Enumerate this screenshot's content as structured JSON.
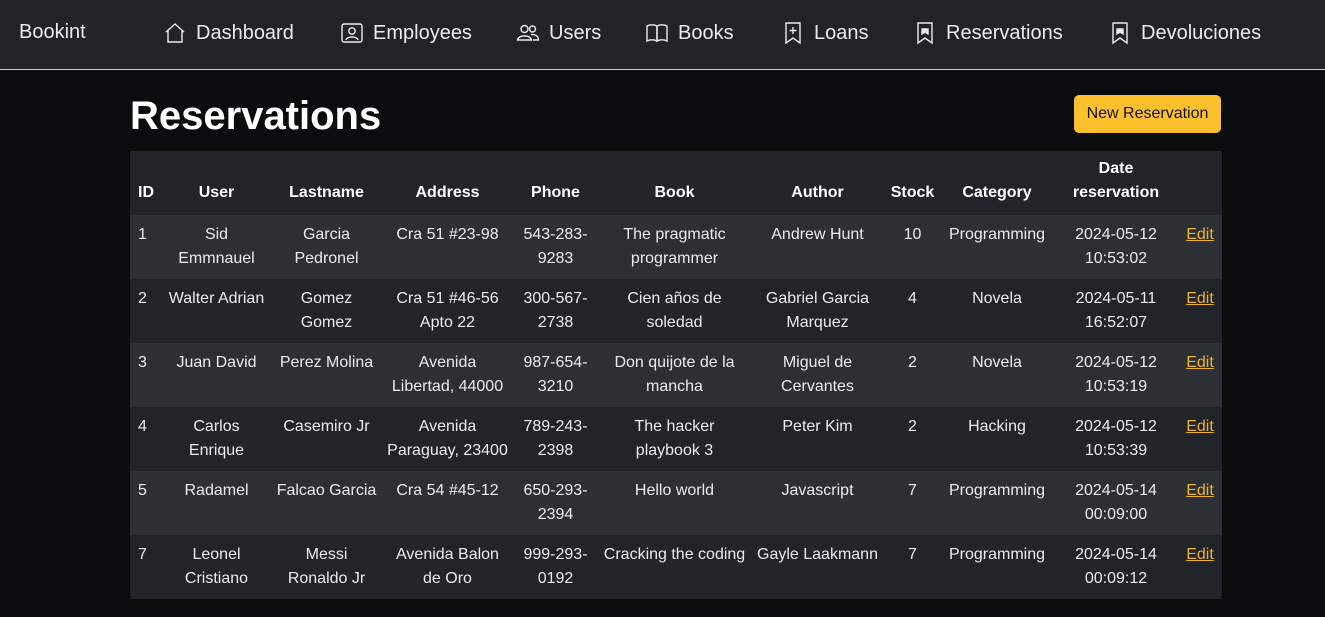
{
  "brand": "Bookint",
  "nav": [
    {
      "label": "Dashboard",
      "icon": "house-icon"
    },
    {
      "label": "Employees",
      "icon": "person-badge-icon"
    },
    {
      "label": "Users",
      "icon": "people-icon"
    },
    {
      "label": "Books",
      "icon": "book-icon"
    },
    {
      "label": "Loans",
      "icon": "bookmark-plus-icon"
    },
    {
      "label": "Reservations",
      "icon": "bookmark-icon"
    },
    {
      "label": "Devoluciones",
      "icon": "bookmark-icon"
    }
  ],
  "page_title": "Reservations",
  "new_button": "New Reservation",
  "table": {
    "headers": [
      "ID",
      "User",
      "Lastname",
      "Address",
      "Phone",
      "Book",
      "Author",
      "Stock",
      "Category",
      "Date reservation",
      ""
    ],
    "edit_label": "Edit",
    "rows": [
      [
        "1",
        "Sid Emmnauel",
        "Garcia Pedronel",
        "Cra 51 #23-98",
        "543-283-9283",
        "The pragmatic programmer",
        "Andrew Hunt",
        "10",
        "Programming",
        "2024-05-12 10:53:02"
      ],
      [
        "2",
        "Walter Adrian",
        "Gomez Gomez",
        "Cra 51 #46-56 Apto 22",
        "300-567-2738",
        "Cien años de soledad",
        "Gabriel Garcia Marquez",
        "4",
        "Novela",
        "2024-05-11 16:52:07"
      ],
      [
        "3",
        "Juan David",
        "Perez Molina",
        "Avenida Libertad, 44000",
        "987-654-3210",
        "Don quijote de la mancha",
        "Miguel de Cervantes",
        "2",
        "Novela",
        "2024-05-12 10:53:19"
      ],
      [
        "4",
        "Carlos Enrique",
        "Casemiro Jr",
        "Avenida Paraguay, 23400",
        "789-243-2398",
        "The hacker playbook 3",
        "Peter Kim",
        "2",
        "Hacking",
        "2024-05-12 10:53:39"
      ],
      [
        "5",
        "Radamel",
        "Falcao Garcia",
        "Cra 54 #45-12",
        "650-293-2394",
        "Hello world",
        "Javascript",
        "7",
        "Programming",
        "2024-05-14 00:09:00"
      ],
      [
        "7",
        "Leonel Cristiano",
        "Messi Ronaldo Jr",
        "Avenida Balon de Oro",
        "999-293-0192",
        "Cracking the coding",
        "Gayle Laakmann",
        "7",
        "Programming",
        "2024-05-14 00:09:12"
      ]
    ]
  }
}
